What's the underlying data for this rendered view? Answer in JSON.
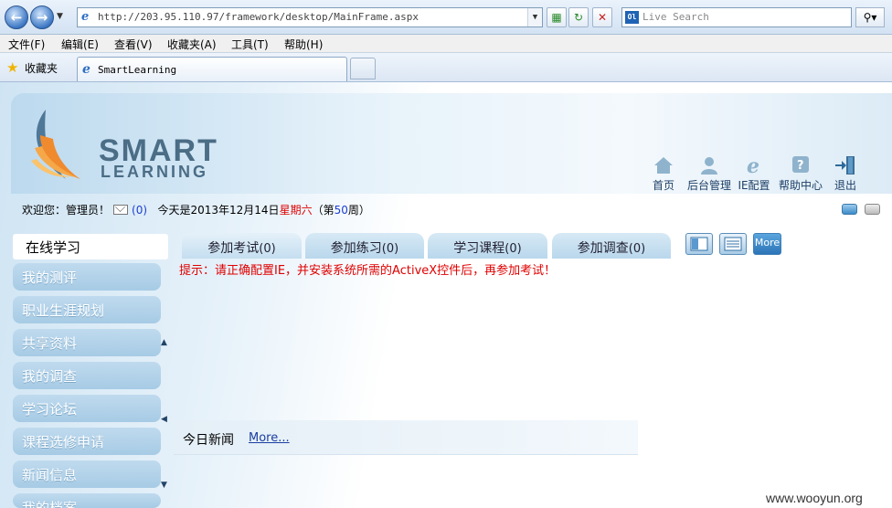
{
  "browser": {
    "url": "http://203.95.110.97/framework/desktop/MainFrame.aspx",
    "search_placeholder": "Live Search",
    "menu": [
      "文件(F)",
      "编辑(E)",
      "查看(V)",
      "收藏夹(A)",
      "工具(T)",
      "帮助(H)"
    ],
    "favorites_label": "收藏夹",
    "tab_title": "SmartLearning"
  },
  "header": {
    "logo_line1": "SMART",
    "logo_line2": "LEARNING",
    "nav": [
      {
        "label": "首页",
        "icon": "home-icon"
      },
      {
        "label": "后台管理",
        "icon": "admin-user-icon"
      },
      {
        "label": "IE配置",
        "icon": "ie-icon"
      },
      {
        "label": "帮助中心",
        "icon": "help-icon"
      },
      {
        "label": "退出",
        "icon": "exit-icon"
      }
    ]
  },
  "welcome": {
    "greeting": "欢迎您：管理员！",
    "mail_count": "(0)",
    "today_prefix": "今天是2013年12月14日",
    "weekday": "星期六",
    "week_prefix": "（第",
    "week_num": "50",
    "week_suffix": "周）"
  },
  "sidebar": {
    "header": "在线学习",
    "items": [
      "我的测评",
      "职业生涯规划",
      "共享资料",
      "我的调查",
      "学习论坛",
      "课程选修申请",
      "新闻信息",
      "我的档案"
    ]
  },
  "tabs": [
    {
      "label": "参加考试",
      "count": "(0)"
    },
    {
      "label": "参加练习",
      "count": "(0)"
    },
    {
      "label": "学习课程",
      "count": "(0)"
    },
    {
      "label": "参加调查",
      "count": "(0)"
    }
  ],
  "more_button": "More",
  "tip": "提示：请正确配置IE，并安装系统所需的ActiveX控件后，再参加考试！",
  "news": {
    "title": "今日新闻",
    "more": "More..."
  },
  "watermark": "www.wooyun.org"
}
